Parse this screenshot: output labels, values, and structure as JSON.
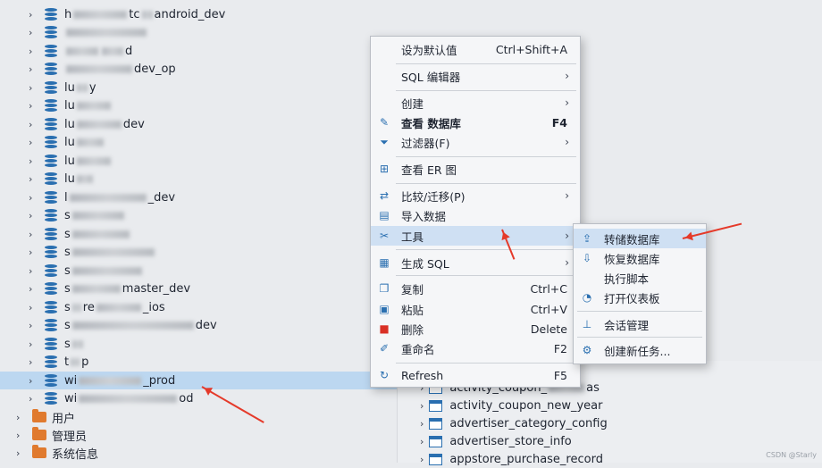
{
  "tree": {
    "items": [
      {
        "pre": "h",
        "w1": 60,
        "mid": "tc",
        "w2": 12,
        "post": "android_dev"
      },
      {
        "pre": "",
        "w1": 90,
        "mid": "",
        "w2": 0,
        "post": ""
      },
      {
        "pre": "",
        "w1": 36,
        "mid": "",
        "w2": 24,
        "post": "d"
      },
      {
        "pre": "",
        "w1": 74,
        "mid": "",
        "w2": 0,
        "post": "dev_op"
      },
      {
        "pre": "lu",
        "w1": 12,
        "mid": "",
        "w2": 0,
        "post": "y"
      },
      {
        "pre": "lu",
        "w1": 38,
        "mid": "",
        "w2": 0,
        "post": ""
      },
      {
        "pre": "lu",
        "w1": 50,
        "mid": "",
        "w2": 0,
        "post": "dev"
      },
      {
        "pre": "lu",
        "w1": 30,
        "mid": "",
        "w2": 0,
        "post": ""
      },
      {
        "pre": "lu",
        "w1": 38,
        "mid": "",
        "w2": 0,
        "post": ""
      },
      {
        "pre": "lu",
        "w1": 18,
        "mid": "",
        "w2": 0,
        "post": ""
      },
      {
        "pre": "l",
        "w1": 86,
        "mid": "",
        "w2": 0,
        "post": "_dev"
      },
      {
        "pre": "s",
        "w1": 58,
        "mid": "",
        "w2": 0,
        "post": ""
      },
      {
        "pre": "s",
        "w1": 64,
        "mid": "",
        "w2": 0,
        "post": ""
      },
      {
        "pre": "s",
        "w1": 92,
        "mid": "",
        "w2": 0,
        "post": ""
      },
      {
        "pre": "s",
        "w1": 78,
        "mid": "",
        "w2": 0,
        "post": ""
      },
      {
        "pre": "s",
        "w1": 54,
        "mid": "",
        "w2": 0,
        "post": "master_dev"
      },
      {
        "pre": "s",
        "w1": 10,
        "mid": "re",
        "w2": 50,
        "post": "_ios"
      },
      {
        "pre": "s",
        "w1": 136,
        "mid": "",
        "w2": 0,
        "post": "dev"
      },
      {
        "pre": "s",
        "w1": 12,
        "mid": "",
        "w2": 0,
        "post": ""
      },
      {
        "pre": "t",
        "w1": 10,
        "mid": "",
        "w2": 0,
        "post": "p"
      },
      {
        "pre": "wi",
        "w1": 70,
        "mid": "",
        "w2": 0,
        "post": "_prod"
      },
      {
        "pre": "wi",
        "w1": 110,
        "mid": "",
        "w2": 0,
        "post": "od"
      }
    ],
    "folders": [
      "用户",
      "管理员",
      "系统信息"
    ]
  },
  "menu": {
    "items": [
      {
        "icon": "",
        "label": "设为默认值",
        "shortcut": "Ctrl+Shift+A",
        "arrow": ""
      },
      {
        "icon": "",
        "label": "SQL 编辑器",
        "shortcut": "",
        "arrow": "›"
      },
      {
        "icon": "",
        "label": "创建",
        "shortcut": "",
        "arrow": "›"
      },
      {
        "icon": "✎",
        "label": "查看 数据库",
        "shortcut": "F4",
        "arrow": ""
      },
      {
        "icon": "⏷",
        "label": "过滤器(F)",
        "shortcut": "",
        "arrow": "›"
      },
      {
        "icon": "⊞",
        "label": "查看 ER 图",
        "shortcut": "",
        "arrow": ""
      },
      {
        "icon": "⇄",
        "label": "比较/迁移(P)",
        "shortcut": "",
        "arrow": "›"
      },
      {
        "icon": "▤",
        "label": "导入数据",
        "shortcut": "",
        "arrow": ""
      },
      {
        "icon": "✂",
        "label": "工具",
        "shortcut": "",
        "arrow": "›"
      },
      {
        "icon": "▦",
        "label": "生成 SQL",
        "shortcut": "",
        "arrow": "›"
      },
      {
        "icon": "❐",
        "label": "复制",
        "shortcut": "Ctrl+C",
        "arrow": ""
      },
      {
        "icon": "▣",
        "label": "粘贴",
        "shortcut": "Ctrl+V",
        "arrow": ""
      },
      {
        "icon": "■",
        "label": "删除",
        "shortcut": "Delete",
        "arrow": ""
      },
      {
        "icon": "✐",
        "label": "重命名",
        "shortcut": "F2",
        "arrow": ""
      },
      {
        "icon": "↻",
        "label": "Refresh",
        "shortcut": "F5",
        "arrow": ""
      }
    ]
  },
  "submenu": {
    "items": [
      {
        "icon": "⇪",
        "label": "转储数据库"
      },
      {
        "icon": "⇩",
        "label": "恢复数据库"
      },
      {
        "icon": "",
        "label": "执行脚本"
      },
      {
        "icon": "◔",
        "label": "打开仪表板"
      },
      {
        "icon": "⊥",
        "label": "会话管理"
      },
      {
        "icon": "⚙",
        "label": "创建新任务..."
      }
    ]
  },
  "tables": {
    "items": [
      "activity_coupon_",
      "activity_coupon_new_year",
      "advertiser_category_config",
      "advertiser_store_info",
      "appstore_purchase_record"
    ],
    "suffix_first": "as"
  },
  "watermark": "CSDN @Starly",
  "colors": {
    "accent": "#2a6fb0",
    "highlight": "#cfe0f3",
    "selection": "#bcd7f0",
    "annotation": "#e53a2a"
  }
}
